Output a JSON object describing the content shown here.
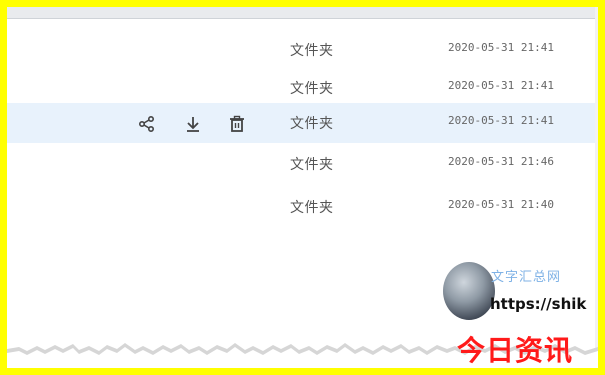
{
  "files": [
    {
      "type": "文件夹",
      "modified": "2020-05-31 21:41"
    },
    {
      "type": "文件夹",
      "modified": "2020-05-31 21:41"
    },
    {
      "type": "文件夹",
      "modified": "2020-05-31 21:41",
      "selected": true
    },
    {
      "type": "文件夹",
      "modified": "2020-05-31 21:46"
    },
    {
      "type": "文件夹",
      "modified": "2020-05-31 21:40"
    }
  ],
  "row_actions": {
    "share_icon": "share-icon",
    "download_icon": "download-icon",
    "delete_icon": "trash-icon"
  },
  "watermark": {
    "title": "文字汇总网",
    "url": "https://shik"
  },
  "brand": "今日资讯",
  "colors": {
    "frame_border": "#ffff00",
    "row_highlight": "#e8f2fc",
    "brand_red": "#ff1a1a"
  }
}
